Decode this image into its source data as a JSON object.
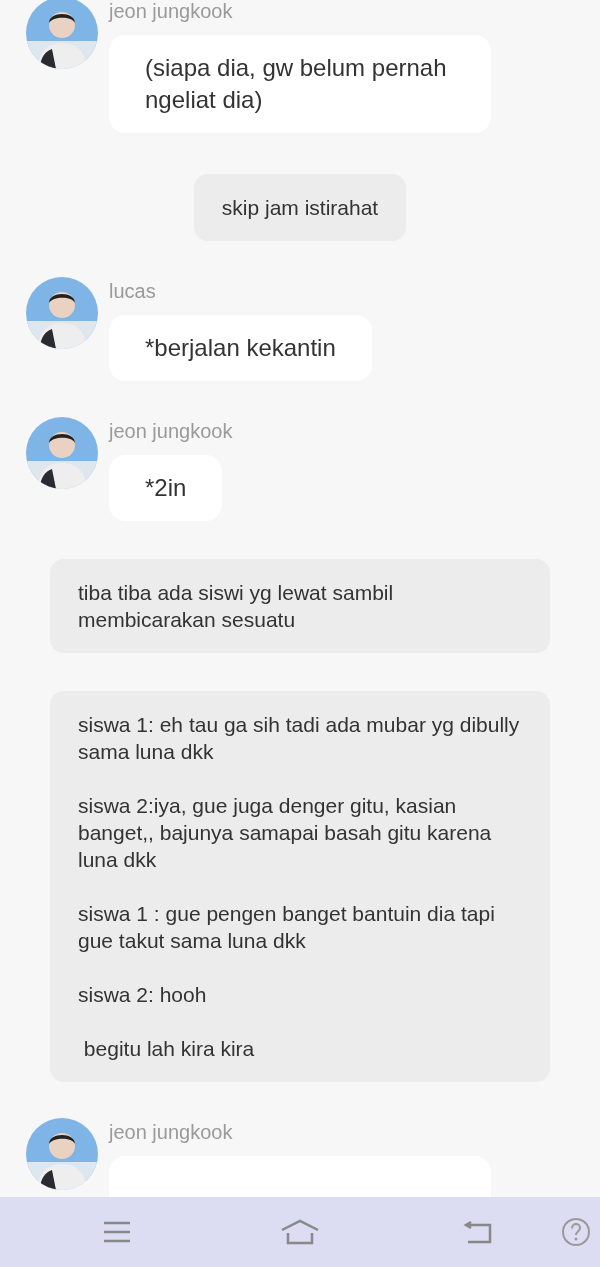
{
  "messages": [
    {
      "kind": "chat",
      "sender": "jeon jungkook",
      "text": "(siapa dia, gw belum pernah ngeliat dia)"
    },
    {
      "kind": "narration",
      "text": "skip jam istirahat"
    },
    {
      "kind": "chat",
      "sender": "lucas",
      "text": "*berjalan kekantin"
    },
    {
      "kind": "chat",
      "sender": "jeon jungkook",
      "text": "*2in"
    },
    {
      "kind": "scene",
      "paragraphs": [
        "tiba tiba ada siswi yg lewat sambil membicarakan sesuatu"
      ]
    },
    {
      "kind": "scene",
      "paragraphs": [
        "siswa 1: eh tau ga sih tadi ada mubar yg dibully sama luna dkk",
        "siswa 2:iya, gue juga denger gitu, kasian banget,, bajunya samapai basah gitu karena luna dkk",
        "siswa 1 : gue pengen banget bantuin dia tapi gue takut sama luna dkk",
        "siswa 2: hooh",
        " begitu lah kira kira"
      ]
    },
    {
      "kind": "chat",
      "sender": "jeon jungkook"
    }
  ]
}
